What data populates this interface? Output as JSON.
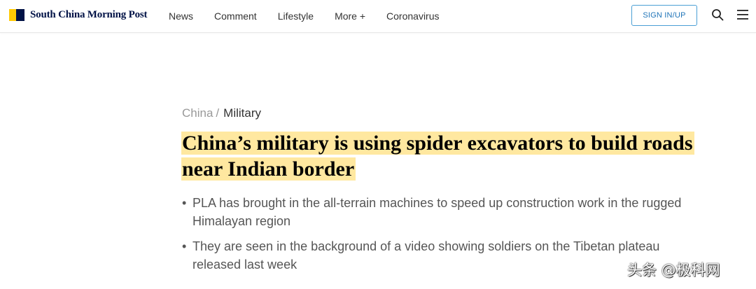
{
  "header": {
    "brand": "South China Morning Post",
    "nav": [
      "News",
      "Comment",
      "Lifestyle",
      "More +",
      "Coronavirus"
    ],
    "signin_label": "SIGN IN/UP",
    "icons": {
      "search": "search-icon",
      "menu": "hamburger-menu-icon"
    },
    "colors": {
      "brand_yellow": "#FFCA05",
      "brand_navy": "#001246",
      "signin_border": "#4b9fd5"
    }
  },
  "article": {
    "breadcrumb": [
      "China",
      "Military"
    ],
    "breadcrumb_separator": "/",
    "headline": "China’s military is using spider excavators to build roads near Indian border",
    "headline_highlight_color": "#FFE8A0",
    "bullet_symbol": "•",
    "summary": [
      "PLA has brought in the all-terrain machines to speed up construction work in the rugged Himalayan region",
      "They are seen in the background of a video showing soldiers on the Tibetan plateau released last week"
    ]
  },
  "watermark": "头条 @极科网"
}
